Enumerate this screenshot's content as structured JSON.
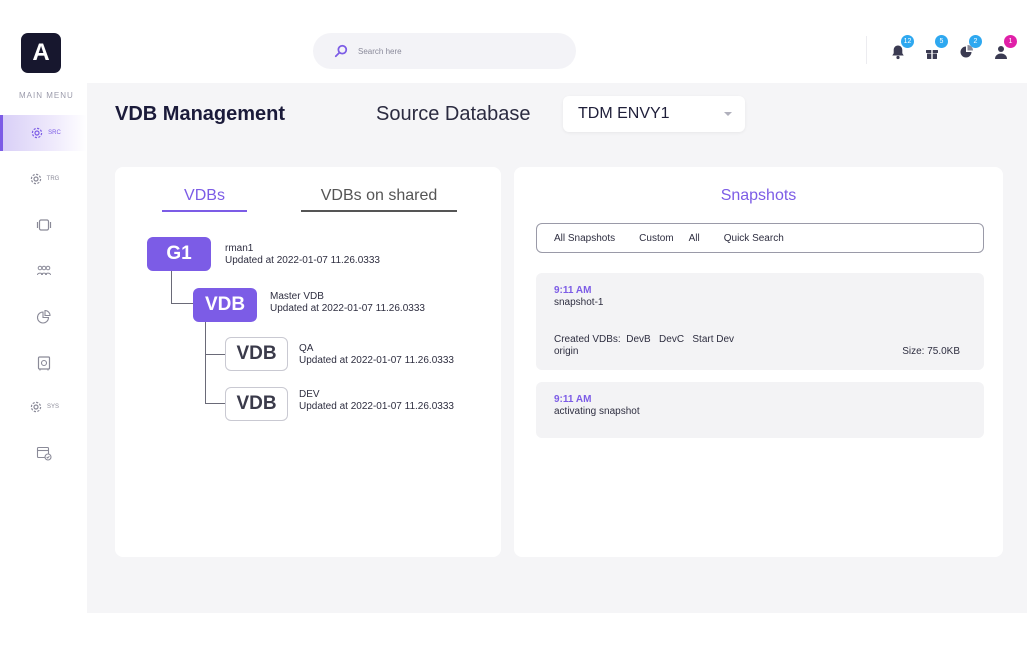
{
  "header": {
    "logo_text": "A",
    "search_placeholder": "Search here",
    "notifications": [
      {
        "icon": "bell-icon",
        "count": "12",
        "color": "#2ea8f0"
      },
      {
        "icon": "gift-icon",
        "count": "5",
        "color": "#2ea8f0"
      },
      {
        "icon": "chart-icon",
        "count": "2",
        "color": "#2ea8f0"
      },
      {
        "icon": "user-icon",
        "count": "1",
        "color": "#e020a8"
      }
    ]
  },
  "sidebar": {
    "title": "MAIN MENU",
    "items": [
      {
        "icon": "gear-icon",
        "label": "SRC",
        "active": true
      },
      {
        "icon": "gear-icon",
        "label": "TRG",
        "active": false
      },
      {
        "icon": "tablet-icon",
        "label": "",
        "active": false
      },
      {
        "icon": "users-icon",
        "label": "",
        "active": false
      },
      {
        "icon": "pie-chart-icon",
        "label": "",
        "active": false
      },
      {
        "icon": "safe-icon",
        "label": "",
        "active": false
      },
      {
        "icon": "gear-icon",
        "label": "SYS",
        "active": false
      },
      {
        "icon": "calendar-check-icon",
        "label": "",
        "active": false
      }
    ]
  },
  "page": {
    "title": "VDB Management",
    "source_label": "Source Database",
    "source_value": "TDM ENVY1"
  },
  "tree": {
    "tabs": {
      "active": "VDBs",
      "other": "VDBs on shared"
    },
    "nodes": [
      {
        "badge": "G1",
        "name": "rman1",
        "updated": "Updated at 2022-01-07 11.26.0333"
      },
      {
        "badge": "VDB",
        "name": "Master VDB",
        "updated": "Updated at 2022-01-07 11.26.0333"
      },
      {
        "badge": "VDB",
        "name": "QA",
        "updated": "Updated at 2022-01-07 11.26.0333"
      },
      {
        "badge": "VDB",
        "name": "DEV",
        "updated": "Updated at 2022-01-07 11.26.0333"
      }
    ]
  },
  "snapshots": {
    "title": "Snapshots",
    "filters": [
      "All Snapshots",
      "Custom",
      "All",
      "Quick Search"
    ],
    "items": [
      {
        "time": "9:11 AM",
        "name": "snapshot-1",
        "created": "Created VDBs:  DevB   DevC   Start Dev",
        "origin": "origin",
        "size": "Size: 75.0KB"
      },
      {
        "time": "9:11 AM",
        "name": "activating snapshot"
      }
    ]
  },
  "colors": {
    "accent": "#7c5ce6",
    "logo_bg": "#17172e",
    "badge_blue": "#2ea8f0",
    "badge_pink": "#e020a8"
  }
}
